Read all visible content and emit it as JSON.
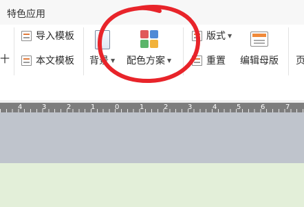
{
  "tab_title": "特色应用",
  "ribbon": {
    "left_cut_glyph": "十",
    "import_template": "导入模板",
    "text_template": "本文模板",
    "background": "背景",
    "color_scheme": "配色方案",
    "layout": "版式",
    "reset": "重置",
    "edit_master": "编辑母版",
    "right_cut": "页"
  },
  "ruler_numbers": [
    "4",
    "3",
    "2",
    "1",
    "0",
    "1",
    "2",
    "3",
    "4",
    "5",
    "6",
    "7"
  ],
  "colors": {
    "palette": [
      "#e0595a",
      "#4f8ad6",
      "#5bb56a",
      "#f2b23a"
    ],
    "annotation": "#e8242a",
    "ruler_bg": "#7d7d7d",
    "slide_area": "#bfc4cc",
    "slide": "#e3efd9"
  },
  "icons": {
    "import_template": "doc-template-icon",
    "text_template": "doc-list-icon",
    "background": "page-icon",
    "color_scheme": "palette-icon",
    "layout": "layout-icon",
    "reset": "reset-icon",
    "edit_master": "master-icon"
  }
}
